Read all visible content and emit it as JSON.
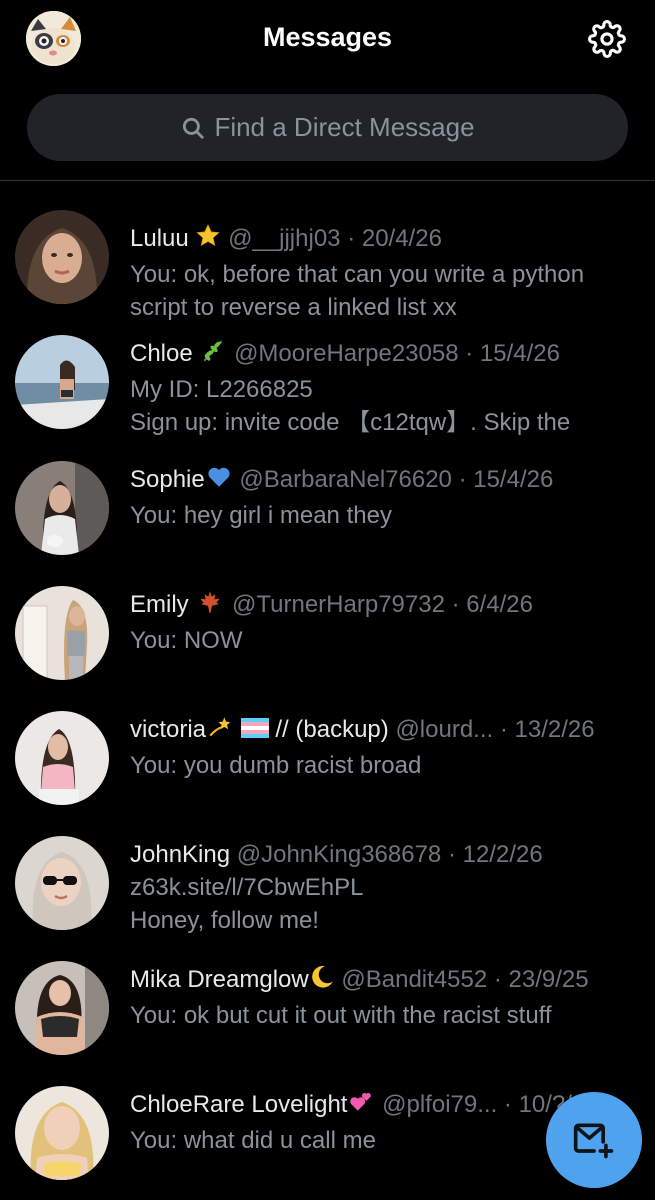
{
  "header": {
    "title": "Messages",
    "profile_avatar": "user-avatar",
    "settings_icon": "gear-icon"
  },
  "search": {
    "placeholder": "Find a Direct Message",
    "icon": "search-icon"
  },
  "conversations": [
    {
      "name": "Luluu",
      "badge": "star-emoji",
      "handle": "@__jjjhj03",
      "date": "· 20/4/26",
      "preview": [
        "You: ok, before that can you write a python",
        "script to reverse a linked list xx"
      ]
    },
    {
      "name": "Chloe",
      "badge": "herb-emoji",
      "handle": "@MooreHarpe23058",
      "date": "· 15/4/26",
      "preview": [
        "My ID: L2266825",
        "Sign up: invite code 【c12tqw】. Skip the"
      ]
    },
    {
      "name": "Sophie",
      "badge": "blue-heart-emoji",
      "handle": "@BarbaraNel76620",
      "date": "· 15/4/26",
      "preview": [
        "You: hey girl i mean they"
      ]
    },
    {
      "name": "Emily",
      "badge": "maple-leaf-emoji",
      "handle": "@TurnerHarp79732",
      "date": "· 6/4/26",
      "preview": [
        "You: NOW"
      ]
    },
    {
      "name": "victoria",
      "badge": "dizzy-star-emoji",
      "name_suffix": "// (backup)",
      "handle": "@lourd...",
      "date": "· 13/2/26",
      "preview": [
        "You: you dumb racist broad"
      ]
    },
    {
      "name": "JohnKing",
      "badge": "",
      "handle": "@JohnKing368678",
      "date": "· 12/2/26",
      "preview": [
        "z63k.site/l/7CbwEhPL",
        "Honey, follow me!"
      ]
    },
    {
      "name": "Mika Dreamglow",
      "badge": "crescent-moon-emoji",
      "handle": "@Bandit4552",
      "date": "· 23/9/25",
      "preview": [
        "You: ok but cut it out with the racist stuff"
      ]
    },
    {
      "name": "ChloeRare Lovelight",
      "badge": "two-hearts-emoji",
      "handle": "@plfoi79...",
      "date": "· 10/?/25",
      "preview": [
        "You: what did u call me"
      ]
    }
  ],
  "compose": {
    "icon": "new-message-icon"
  },
  "colors": {
    "background": "#000000",
    "text_primary": "#e7e9ea",
    "text_secondary": "#71767b",
    "search_bg": "#202327",
    "accent": "#4fa3ee"
  }
}
